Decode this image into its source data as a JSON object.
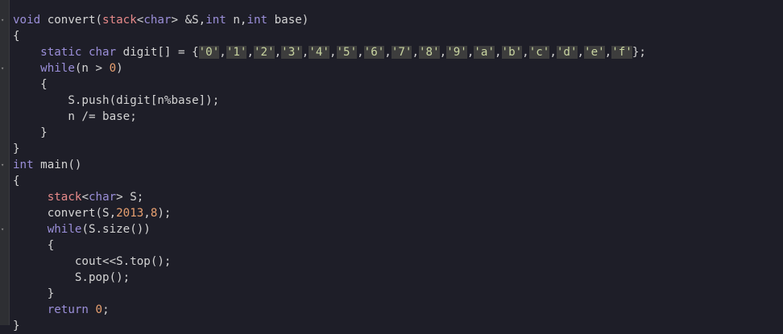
{
  "editor": {
    "lines": [
      [
        {
          "t": "void",
          "c": "kw"
        },
        {
          "t": " convert(",
          "c": "plain"
        },
        {
          "t": "stack",
          "c": "ptype"
        },
        {
          "t": "<",
          "c": "plain"
        },
        {
          "t": "char",
          "c": "kw"
        },
        {
          "t": "> &S,",
          "c": "plain"
        },
        {
          "t": "int",
          "c": "kw"
        },
        {
          "t": " n,",
          "c": "plain"
        },
        {
          "t": "int",
          "c": "kw"
        },
        {
          "t": " base)",
          "c": "plain"
        }
      ],
      [
        {
          "t": "{",
          "c": "plain"
        }
      ],
      [
        {
          "t": "    ",
          "c": "plain"
        },
        {
          "t": "static",
          "c": "kw"
        },
        {
          "t": " ",
          "c": "plain"
        },
        {
          "t": "char",
          "c": "kw"
        },
        {
          "t": " digit[] = {",
          "c": "plain"
        },
        {
          "t": "'0'",
          "c": "str"
        },
        {
          "t": ",",
          "c": "plain"
        },
        {
          "t": "'1'",
          "c": "str"
        },
        {
          "t": ",",
          "c": "plain"
        },
        {
          "t": "'2'",
          "c": "str"
        },
        {
          "t": ",",
          "c": "plain"
        },
        {
          "t": "'3'",
          "c": "str"
        },
        {
          "t": ",",
          "c": "plain"
        },
        {
          "t": "'4'",
          "c": "str"
        },
        {
          "t": ",",
          "c": "plain"
        },
        {
          "t": "'5'",
          "c": "str"
        },
        {
          "t": ",",
          "c": "plain"
        },
        {
          "t": "'6'",
          "c": "str"
        },
        {
          "t": ",",
          "c": "plain"
        },
        {
          "t": "'7'",
          "c": "str"
        },
        {
          "t": ",",
          "c": "plain"
        },
        {
          "t": "'8'",
          "c": "str"
        },
        {
          "t": ",",
          "c": "plain"
        },
        {
          "t": "'9'",
          "c": "str"
        },
        {
          "t": ",",
          "c": "plain"
        },
        {
          "t": "'a'",
          "c": "str"
        },
        {
          "t": ",",
          "c": "plain"
        },
        {
          "t": "'b'",
          "c": "str"
        },
        {
          "t": ",",
          "c": "plain"
        },
        {
          "t": "'c'",
          "c": "str"
        },
        {
          "t": ",",
          "c": "plain"
        },
        {
          "t": "'d'",
          "c": "str"
        },
        {
          "t": ",",
          "c": "plain"
        },
        {
          "t": "'e'",
          "c": "str"
        },
        {
          "t": ",",
          "c": "plain"
        },
        {
          "t": "'f'",
          "c": "str"
        },
        {
          "t": "};",
          "c": "plain"
        }
      ],
      [
        {
          "t": "    ",
          "c": "plain"
        },
        {
          "t": "while",
          "c": "kw"
        },
        {
          "t": "(n > ",
          "c": "plain"
        },
        {
          "t": "0",
          "c": "num"
        },
        {
          "t": ")",
          "c": "plain"
        }
      ],
      [
        {
          "t": "    {",
          "c": "plain"
        }
      ],
      [
        {
          "t": "        S.push(digit[n%base]);",
          "c": "plain"
        }
      ],
      [
        {
          "t": "        n /= base;",
          "c": "plain"
        }
      ],
      [
        {
          "t": "    }",
          "c": "plain"
        }
      ],
      [
        {
          "t": "}",
          "c": "plain"
        }
      ],
      [
        {
          "t": "int",
          "c": "kw"
        },
        {
          "t": " main()",
          "c": "plain"
        }
      ],
      [
        {
          "t": "{",
          "c": "plain"
        }
      ],
      [
        {
          "t": "     ",
          "c": "plain"
        },
        {
          "t": "stack",
          "c": "ptype"
        },
        {
          "t": "<",
          "c": "plain"
        },
        {
          "t": "char",
          "c": "kw"
        },
        {
          "t": "> S;",
          "c": "plain"
        }
      ],
      [
        {
          "t": "     convert(S,",
          "c": "plain"
        },
        {
          "t": "2013",
          "c": "num"
        },
        {
          "t": ",",
          "c": "plain"
        },
        {
          "t": "8",
          "c": "num"
        },
        {
          "t": ");",
          "c": "plain"
        }
      ],
      [
        {
          "t": "     ",
          "c": "plain"
        },
        {
          "t": "while",
          "c": "kw"
        },
        {
          "t": "(S.size())",
          "c": "plain"
        }
      ],
      [
        {
          "t": "     {",
          "c": "plain"
        }
      ],
      [
        {
          "t": "         cout<<S.top();",
          "c": "plain"
        }
      ],
      [
        {
          "t": "         S.pop();",
          "c": "plain"
        }
      ],
      [
        {
          "t": "     }",
          "c": "plain"
        }
      ],
      [
        {
          "t": "     ",
          "c": "plain"
        },
        {
          "t": "return",
          "c": "kw"
        },
        {
          "t": " ",
          "c": "plain"
        },
        {
          "t": "0",
          "c": "num"
        },
        {
          "t": ";",
          "c": "plain"
        }
      ],
      [
        {
          "t": "}",
          "c": "plain"
        }
      ]
    ],
    "colors": {
      "background": "#1e1e28",
      "keyword": "#9b8fd9",
      "number": "#e8a070",
      "template_type": "#e88a8a",
      "char_literal": "#c8d4a0",
      "char_literal_bg": "#3d3d3d",
      "text": "#d4d4d4",
      "gutter": "#2e2f33"
    },
    "fold_markers": [
      "fold-icon",
      "fold-icon",
      "fold-icon",
      "fold-icon",
      "fold-icon"
    ]
  }
}
